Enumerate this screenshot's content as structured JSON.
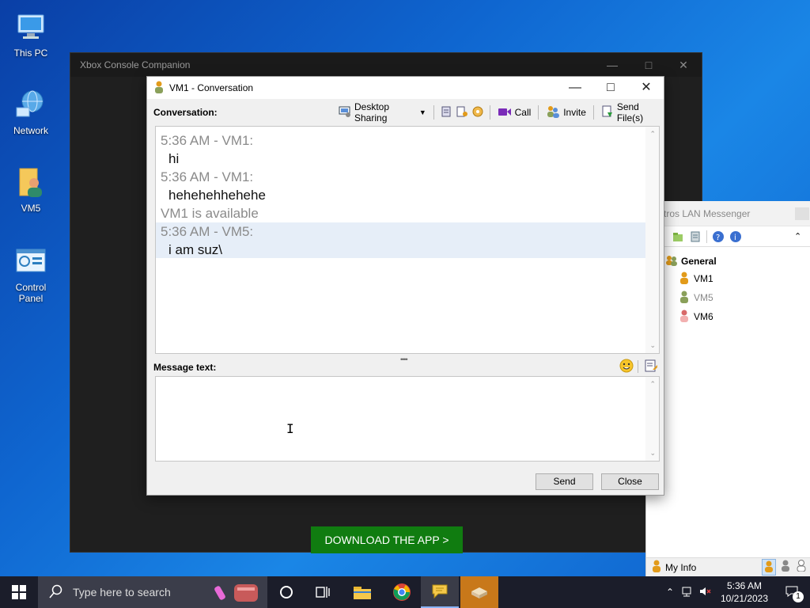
{
  "desktop": {
    "icons": [
      {
        "label": "This PC"
      },
      {
        "label": "Network"
      },
      {
        "label": "VM5"
      },
      {
        "label": "Control Panel"
      }
    ]
  },
  "xbox_window": {
    "title": "Xbox Console Companion",
    "download_button": "DOWNLOAD THE APP >"
  },
  "lan_messenger": {
    "title": "tros LAN Messenger",
    "group": "General",
    "users": [
      {
        "name": "VM1",
        "status_color": "#e29b1a"
      },
      {
        "name": "VM5",
        "status_color": "#8aa05a"
      },
      {
        "name": "VM6",
        "status_color": "#d86a6a"
      }
    ],
    "my_info_label": "My Info"
  },
  "conversation": {
    "title": "VM1 - Conversation",
    "conversation_label": "Conversation:",
    "toolbar": {
      "desktop_sharing": "Desktop Sharing",
      "call": "Call",
      "invite": "Invite",
      "send_files": "Send File(s)"
    },
    "messages": [
      {
        "header": "5:36 AM - VM1:",
        "body": "hi"
      },
      {
        "header": "5:36 AM - VM1:",
        "body": "hehehehhehehe"
      }
    ],
    "status_line": "VM1 is available",
    "own_message": {
      "header": "5:36 AM - VM5:",
      "body": "i am suz\\"
    },
    "message_text_label": "Message text:",
    "input_value": "",
    "send_button": "Send",
    "close_button": "Close"
  },
  "taskbar": {
    "search_placeholder": "Type here to search",
    "time": "5:36 AM",
    "date": "10/21/2023",
    "notification_count": "1"
  },
  "colors": {
    "xbox_green": "#107c10",
    "desktop_blue": "#0f66d0",
    "taskbar_bg": "#1b1d2a"
  }
}
